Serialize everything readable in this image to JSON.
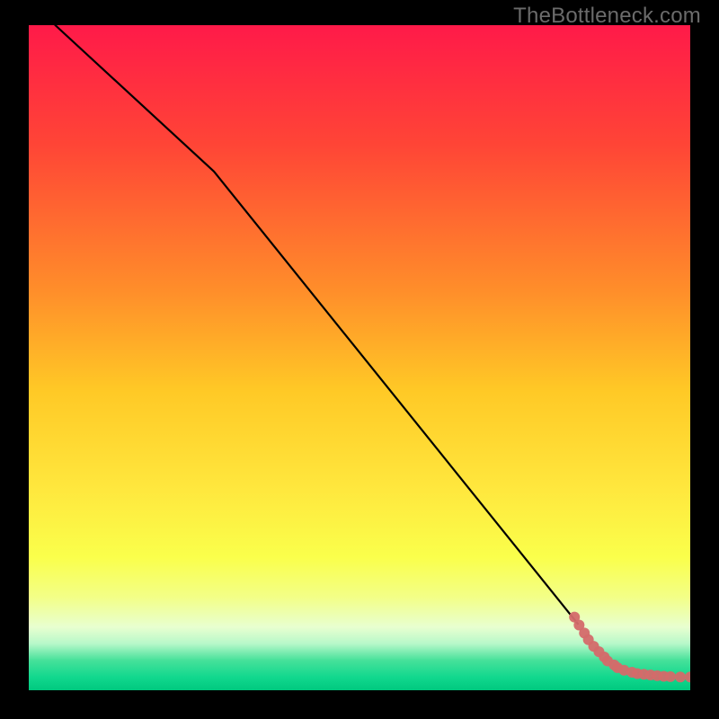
{
  "watermark": "TheBottleneck.com",
  "chart_data": {
    "type": "line",
    "title": "",
    "xlabel": "",
    "ylabel": "",
    "xlim": [
      0,
      100
    ],
    "ylim": [
      0,
      100
    ],
    "gradient_stops": [
      {
        "offset": 0.0,
        "color": "#ff1a49"
      },
      {
        "offset": 0.18,
        "color": "#ff4536"
      },
      {
        "offset": 0.4,
        "color": "#ff8e2a"
      },
      {
        "offset": 0.55,
        "color": "#ffc926"
      },
      {
        "offset": 0.7,
        "color": "#ffe83e"
      },
      {
        "offset": 0.8,
        "color": "#faff4b"
      },
      {
        "offset": 0.86,
        "color": "#f3ff87"
      },
      {
        "offset": 0.905,
        "color": "#e8ffd0"
      },
      {
        "offset": 0.93,
        "color": "#b7f8c9"
      },
      {
        "offset": 0.955,
        "color": "#46e19a"
      },
      {
        "offset": 0.98,
        "color": "#12d88e"
      },
      {
        "offset": 1.0,
        "color": "#00c97f"
      }
    ],
    "series": [
      {
        "name": "curve",
        "type": "line",
        "color": "#000000",
        "x": [
          4,
          28,
          83
        ],
        "y": [
          100,
          78,
          10
        ]
      },
      {
        "name": "points",
        "type": "scatter",
        "color": "#d46a6a",
        "x": [
          82.5,
          83.2,
          84.0,
          84.6,
          85.4,
          86.2,
          87.0,
          87.5,
          88.5,
          89.0,
          90.0,
          91.2,
          92.0,
          93.0,
          94.0,
          95.0,
          96.0,
          97.0,
          98.5,
          100.0,
          101.5
        ],
        "y": [
          11.0,
          9.8,
          8.6,
          7.6,
          6.6,
          5.8,
          5.0,
          4.4,
          3.8,
          3.4,
          3.0,
          2.7,
          2.5,
          2.4,
          2.3,
          2.2,
          2.1,
          2.05,
          2.0,
          2.0,
          1.9
        ]
      }
    ]
  }
}
